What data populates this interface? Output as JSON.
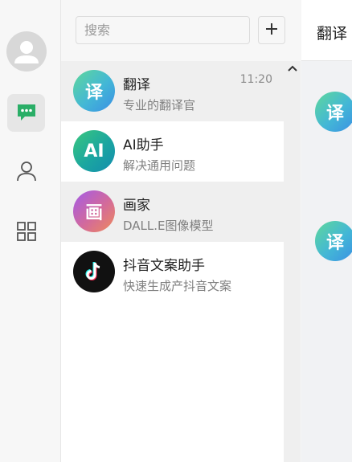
{
  "search": {
    "placeholder": "搜索"
  },
  "add_button": {
    "label": "+"
  },
  "nav": {
    "avatar_icon": "user-avatar-icon",
    "items": [
      {
        "icon": "chat-bubble-icon",
        "active": true,
        "color": "#2aae67"
      },
      {
        "icon": "person-icon",
        "active": false
      },
      {
        "icon": "grid-apps-icon",
        "active": false
      }
    ]
  },
  "conversations": [
    {
      "name": "翻译",
      "desc": "专业的翻译官",
      "time": "11:20",
      "avatar_text": "译",
      "selected": true
    },
    {
      "name": "AI助手",
      "desc": "解决通用问题",
      "time": "",
      "avatar_text": "AI"
    },
    {
      "name": "画家",
      "desc": "DALL.E图像模型",
      "time": "",
      "avatar_text": "画",
      "hovered": true
    },
    {
      "name": "抖音文案助手",
      "desc": "快速生成产抖音文案",
      "time": "",
      "avatar_text": "tiktok-logo-icon"
    }
  ],
  "chat": {
    "title": "翻译",
    "avatar_text": "译"
  },
  "colors": {
    "accent": "#2aae67",
    "rail_bg": "#f7f7f7",
    "selected_bg": "#efefef"
  }
}
